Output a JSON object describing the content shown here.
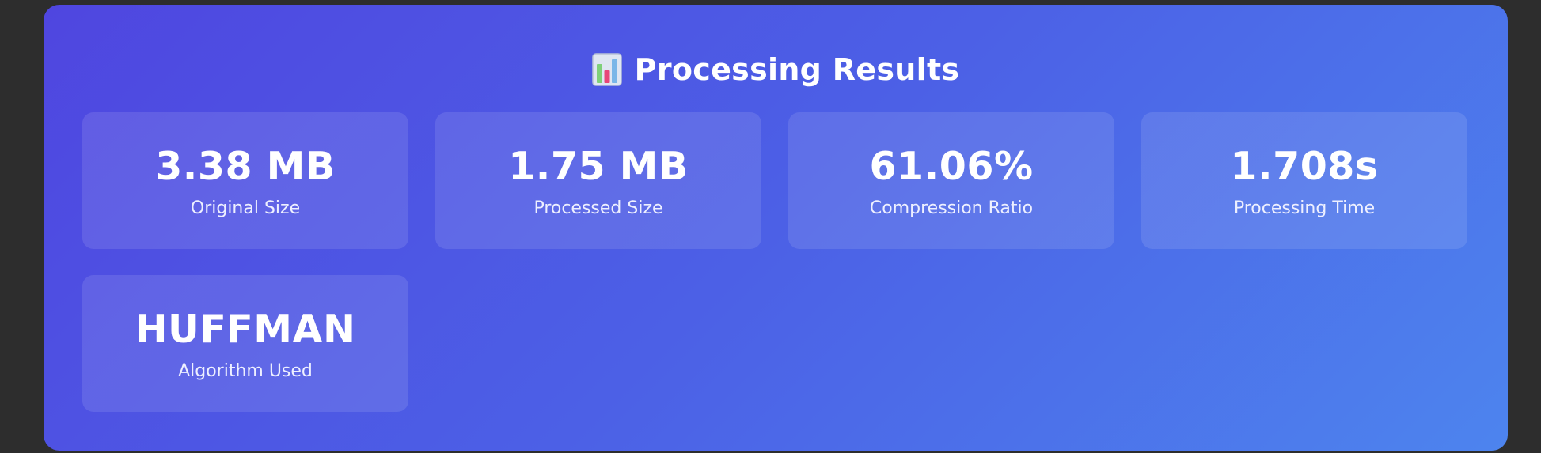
{
  "header": {
    "title": "Processing Results",
    "icon": "bar-chart-icon"
  },
  "results": [
    {
      "value": "3.38 MB",
      "label": "Original Size"
    },
    {
      "value": "1.75 MB",
      "label": "Processed Size"
    },
    {
      "value": "61.06%",
      "label": "Compression Ratio"
    },
    {
      "value": "1.708s",
      "label": "Processing Time"
    },
    {
      "value": "HUFFMAN",
      "label": "Algorithm Used"
    }
  ],
  "colors": {
    "background": "#2d2d2d",
    "panel_gradient_start": "#4f46e0",
    "panel_gradient_end": "#4d84ee",
    "card_background": "rgba(255,255,255,0.11)",
    "text": "#ffffff"
  }
}
